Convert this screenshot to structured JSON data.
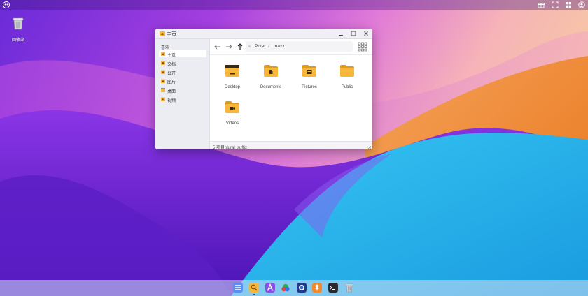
{
  "desktop": {
    "trash_label": "回收站"
  },
  "window": {
    "title": "主页",
    "sidebar": {
      "heading": "喜欢",
      "items": [
        {
          "label": "主页",
          "icon": "home-folder-icon",
          "active": true
        },
        {
          "label": "文档",
          "icon": "folder-icon"
        },
        {
          "label": "公开",
          "icon": "folder-icon"
        },
        {
          "label": "图片",
          "icon": "folder-icon"
        },
        {
          "label": "桌面",
          "icon": "desktop-folder-icon"
        },
        {
          "label": "视频",
          "icon": "folder-icon"
        }
      ]
    },
    "breadcrumb": [
      "Puter",
      "maxx"
    ],
    "files": [
      {
        "label": "Desktop",
        "icon": "desktop-folder-icon"
      },
      {
        "label": "Documents",
        "icon": "documents-folder-icon"
      },
      {
        "label": "Pictures",
        "icon": "pictures-folder-icon"
      },
      {
        "label": "Public",
        "icon": "folder-icon"
      },
      {
        "label": "Videos",
        "icon": "videos-folder-icon"
      }
    ],
    "status": "5 项目plural_suffix"
  },
  "colors": {
    "folder": "#f6b73c",
    "folder_dark": "#e09b1b",
    "accent": "#7a2fd8"
  }
}
